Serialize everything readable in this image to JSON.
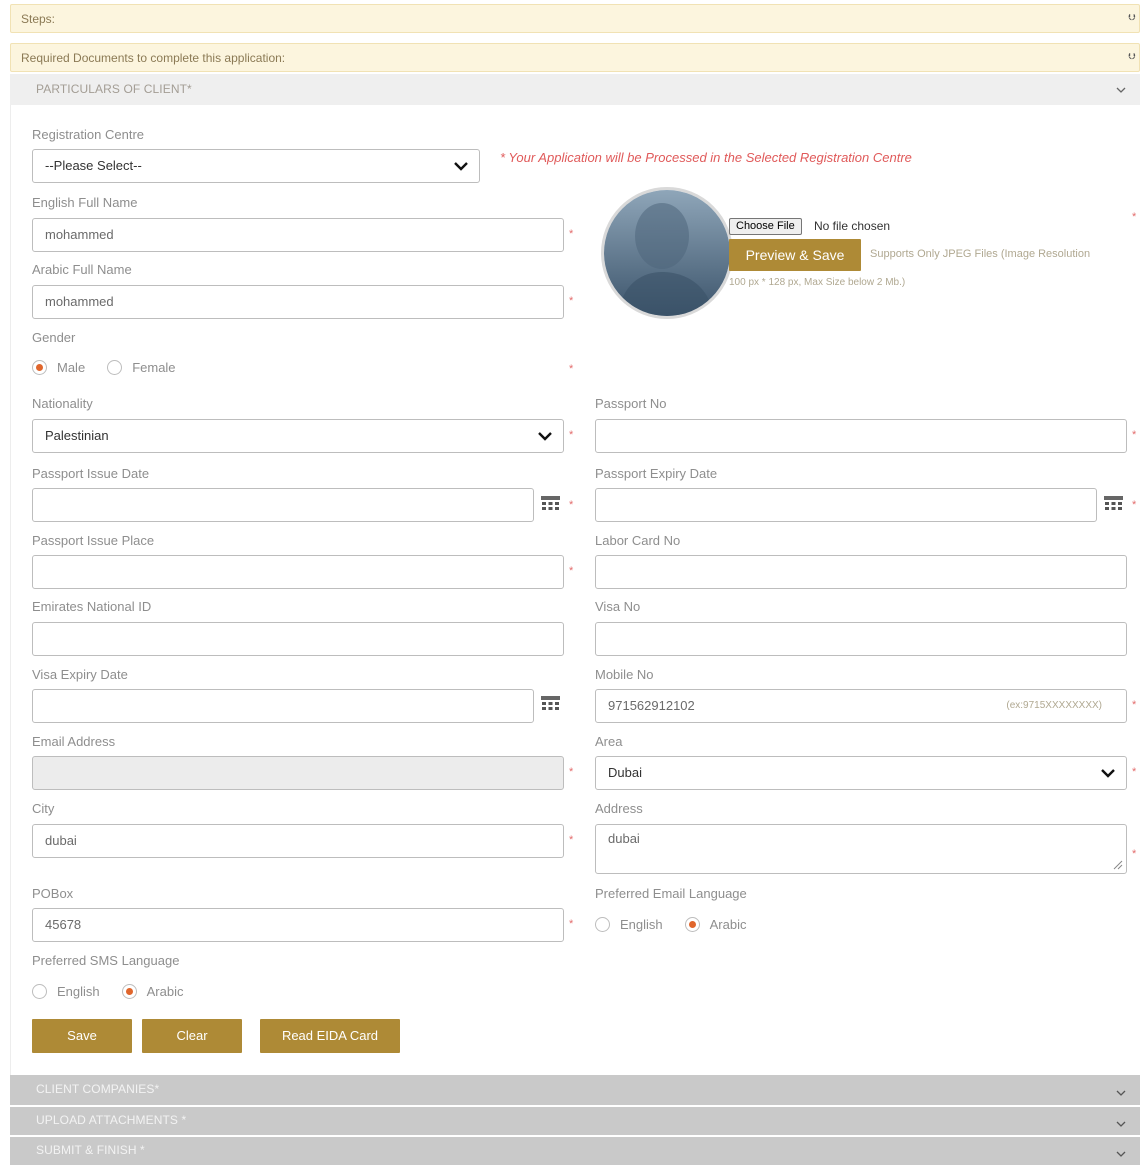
{
  "accordion": {
    "steps_label": "Steps:",
    "required_docs_label": "Required Documents to complete this application:",
    "double_chevron": "»"
  },
  "sections": {
    "particulars": "PARTICULARS OF CLIENT*",
    "client_companies": "CLIENT COMPANIES*",
    "upload_attachments": "UPLOAD ATTACHMENTS *",
    "submit_finish": "SUBMIT & FINISH *",
    "chevron": "⌄"
  },
  "form": {
    "registration_centre": {
      "label": "Registration Centre",
      "value": "--Please Select--"
    },
    "notice": "* Your Application will be Processed in the Selected Registration Centre",
    "english_full_name": {
      "label": "English Full Name",
      "value": "mohammed"
    },
    "arabic_full_name": {
      "label": "Arabic Full Name",
      "value": "mohammed"
    },
    "gender": {
      "label": "Gender",
      "options": [
        "Male",
        "Female"
      ],
      "selected": "Male"
    },
    "photo": {
      "choose_file": "Choose File",
      "file_status": "No file chosen",
      "preview_save": "Preview & Save",
      "supports_note_1": "Supports Only JPEG Files (Image Resolution",
      "supports_note_2": "100 px * 128 px, Max Size below 2 Mb.)"
    },
    "nationality": {
      "label": "Nationality",
      "value": "Palestinian"
    },
    "passport_no": {
      "label": "Passport No",
      "value": ""
    },
    "passport_issue_date": {
      "label": "Passport Issue Date",
      "value": ""
    },
    "passport_expiry_date": {
      "label": "Passport Expiry Date",
      "value": ""
    },
    "passport_issue_place": {
      "label": "Passport Issue Place",
      "value": ""
    },
    "labor_card_no": {
      "label": "Labor Card No",
      "value": ""
    },
    "emirates_national_id": {
      "label": "Emirates National ID",
      "value": ""
    },
    "visa_no": {
      "label": "Visa No",
      "value": ""
    },
    "visa_expiry_date": {
      "label": "Visa Expiry Date",
      "value": ""
    },
    "mobile_no": {
      "label": "Mobile No",
      "value": "971562912102",
      "hint": "(ex:9715XXXXXXXX)"
    },
    "email_address": {
      "label": "Email Address",
      "value": ""
    },
    "area": {
      "label": "Area",
      "value": "Dubai"
    },
    "city": {
      "label": "City",
      "value": "dubai"
    },
    "address": {
      "label": "Address",
      "value": "dubai"
    },
    "pobox": {
      "label": "POBox",
      "value": "45678"
    },
    "preferred_email_language": {
      "label": "Preferred Email Language",
      "options": [
        "English",
        "Arabic"
      ],
      "selected": "Arabic"
    },
    "preferred_sms_language": {
      "label": "Preferred SMS Language",
      "options": [
        "English",
        "Arabic"
      ],
      "selected": "Arabic"
    },
    "required_mark": "*"
  },
  "buttons": {
    "save": "Save",
    "clear": "Clear",
    "read_eida": "Read EIDA Card"
  },
  "colors": {
    "accent": "#ae8a36",
    "required": "#e36b6b",
    "radio_selected": "#e0662c",
    "banner_bg": "#fcf5de"
  },
  "icons": [
    "double-chevron-down-icon",
    "chevron-down-icon",
    "calendar-icon",
    "avatar-silhouette-icon",
    "resize-grip-icon"
  ]
}
